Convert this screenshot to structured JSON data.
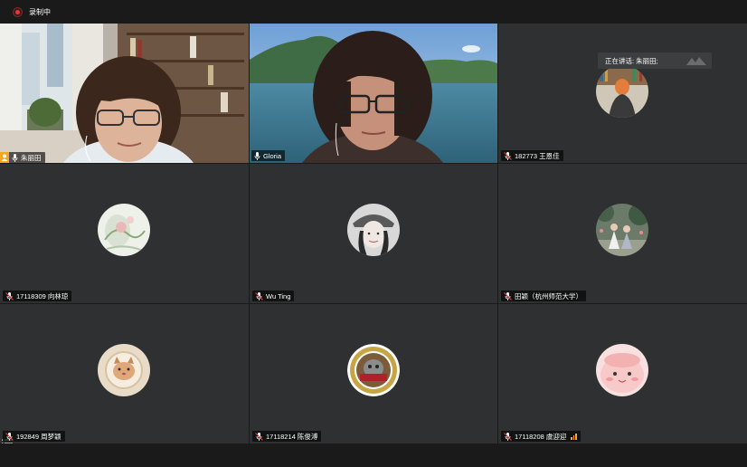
{
  "recording": {
    "label": "录制中"
  },
  "speaking_indicator": {
    "label": "正在讲话: 朱丽田;"
  },
  "participants": [
    {
      "name": "朱丽田",
      "video": true,
      "active": true,
      "host": true
    },
    {
      "name": "Gloria",
      "video": true
    },
    {
      "name": "182773 王恩佳",
      "muted": true
    },
    {
      "name": "17118309 向林琼",
      "muted": true
    },
    {
      "name": "Wu Ting",
      "muted": true
    },
    {
      "name": "田颖（杭州师范大学）",
      "muted": true
    },
    {
      "name": "192849 周梦颖",
      "muted": true
    },
    {
      "name": "17118214 陈俊溥",
      "muted": true
    },
    {
      "name": "17118208 虞迎迎",
      "muted": true,
      "signal": true
    }
  ],
  "colors": {
    "active_border": "#23c552",
    "record": "#e53935",
    "tile_bg": "#2f3031",
    "host_badge": "#f5a623",
    "signal": "#f2b01e"
  }
}
